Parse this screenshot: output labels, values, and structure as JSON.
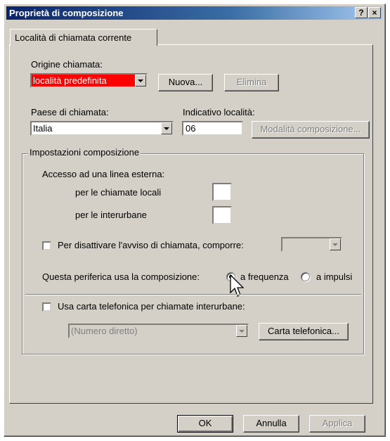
{
  "window": {
    "title": "Proprietà di composizione",
    "help_button": "?",
    "close_button": "×"
  },
  "tab": {
    "label": "Località di chiamata corrente"
  },
  "origin": {
    "label": "Origine chiamata:",
    "value": "località predefinita",
    "new_button": "Nuova...",
    "delete_button": "Elimina"
  },
  "country": {
    "label": "Paese di chiamata:",
    "value": "Italia"
  },
  "area": {
    "label": "Indicativo località:",
    "value": "06",
    "dialing_rules_button": "Modalità composizione..."
  },
  "settings": {
    "group_label": "Impostazioni composizione",
    "outside_line_label": "Accesso ad una linea esterna:",
    "local_label": "per le chiamate locali",
    "local_value": "",
    "long_distance_label": "per le interurbane",
    "long_distance_value": "",
    "call_waiting_label": "Per disattivare l'avviso di chiamata, comporre:",
    "call_waiting_value": "",
    "dial_type_label": "Questa periferica usa la composizione:",
    "tone_label": "a frequenza",
    "pulse_label": "a impulsi",
    "calling_card_label": "Usa carta telefonica per chiamate interurbane:",
    "calling_card_value": "(Numero diretto)",
    "calling_card_button": "Carta telefonica..."
  },
  "footer": {
    "ok": "OK",
    "cancel": "Annulla",
    "apply": "Applica"
  },
  "colors": {
    "titlebar_start": "#0a246a",
    "titlebar_end": "#a6caf0",
    "face": "#d4d0c8",
    "selection": "#ff0000"
  }
}
